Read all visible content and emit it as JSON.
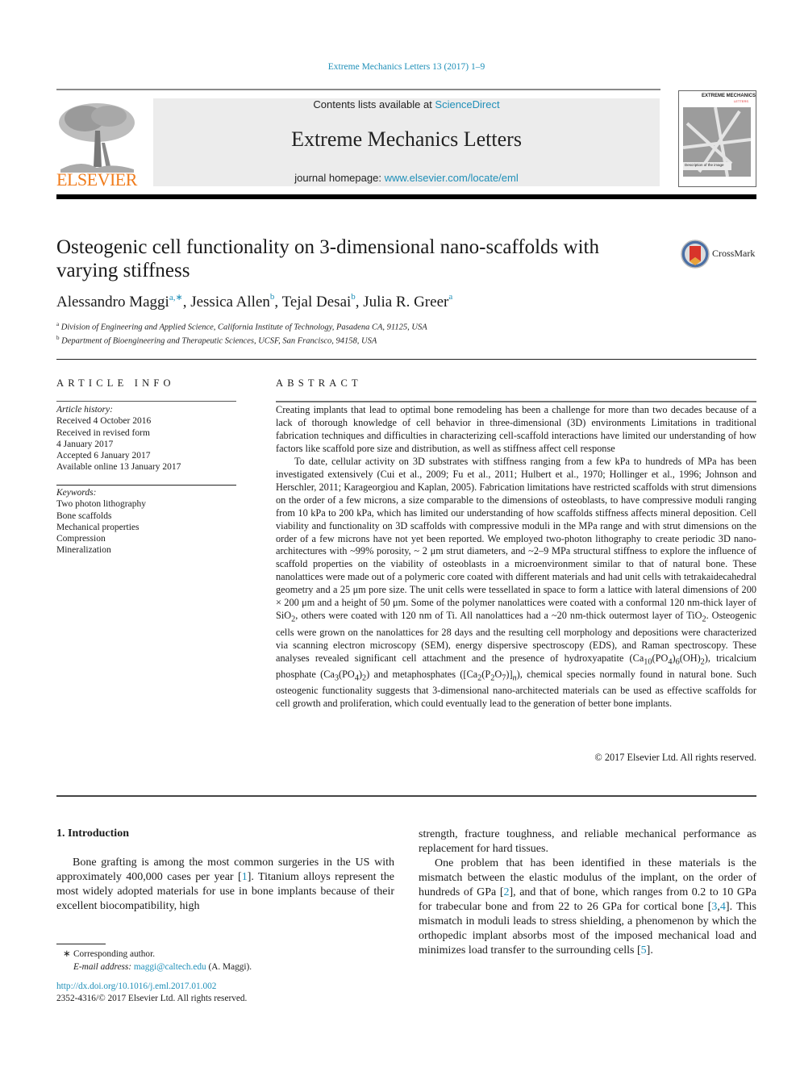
{
  "running_header": "Extreme Mechanics Letters 13 (2017) 1–9",
  "masthead": {
    "contents_prefix": "Contents lists available at ",
    "contents_link": "ScienceDirect",
    "journal_title": "Extreme Mechanics Letters",
    "homepage_prefix": "journal homepage: ",
    "homepage_link": "www.elsevier.com/locate/eml",
    "publisher_logo_text": "ELSEVIER",
    "cover_title": "EXTREME MECHANICS",
    "cover_subtitle": "LETTERS",
    "cover_caption": "Description of the image",
    "colors": {
      "link": "#1e8fb8",
      "elsevier_orange": "#f07c1c",
      "band": "#ececec"
    }
  },
  "article": {
    "title": "Osteogenic cell functionality on 3-dimensional nano-scaffolds with varying stiffness",
    "crossmark_label": "CrossMark",
    "authors": [
      {
        "name": "Alessandro Maggi",
        "sup": "a,∗"
      },
      {
        "name": "Jessica Allen",
        "sup": "b"
      },
      {
        "name": "Tejal Desai",
        "sup": "b"
      },
      {
        "name": "Julia R. Greer",
        "sup": "a"
      }
    ],
    "affiliations": [
      {
        "key": "a",
        "text": "Division of Engineering and Applied Science, California Institute of Technology, Pasadena CA, 91125, USA"
      },
      {
        "key": "b",
        "text": "Department of Bioengineering and Therapeutic Sciences, UCSF, San Francisco, 94158, USA"
      }
    ]
  },
  "article_info": {
    "heading": "ARTICLE INFO",
    "history_label": "Article history:",
    "history": [
      "Received 4 October 2016",
      "Received in revised form",
      "4 January 2017",
      "Accepted 6 January 2017",
      "Available online 13 January 2017"
    ],
    "keywords_label": "Keywords:",
    "keywords": [
      "Two photon lithography",
      "Bone scaffolds",
      "Mechanical properties",
      "Compression",
      "Mineralization"
    ]
  },
  "abstract": {
    "heading": "ABSTRACT",
    "p1": "Creating implants that lead to optimal bone remodeling has been a challenge for more than two decades because of a lack of thorough knowledge of cell behavior in three-dimensional (3D) environments Limitations in traditional fabrication techniques and difficulties in characterizing cell-scaffold interactions have limited our understanding of how factors like scaffold pore size and distribution, as well as stiffness affect cell response",
    "p2_a": "To date, cellular activity on 3D substrates with stiffness ranging from a few kPa to hundreds of MPa has been investigated extensively (Cui et al., 2009; Fu et al., 2011; Hulbert et al., 1970; Hollinger et al., 1996; Johnson and Herschler, 2011; Karageorgiou and Kaplan, 2005). Fabrication limitations have restricted scaffolds with strut dimensions on the order of a few microns, a size comparable to the dimensions of osteoblasts, to have compressive moduli ranging from 10 kPa to 200 kPa, which has limited our understanding of how scaffolds stiffness affects mineral deposition. Cell viability and functionality on 3D scaffolds with compressive moduli in the MPa range and with strut dimensions on the order of a few microns have not yet been reported. We employed two-photon lithography to create periodic 3D nano-architectures with ~99% porosity, ~ 2 μm strut diameters, and ~2–9 MPa structural stiffness to explore the influence of scaffold properties on the viability of osteoblasts in a microenvironment similar to that of natural bone. These nanolattices were made out of a polymeric core coated with different materials and had unit cells with tetrakaidecahedral geometry and a 25 μm pore size. The unit cells were tessellated in space to form a lattice with lateral dimensions of 200 × 200 μm and a height of 50 μm. Some of the polymer nanolattices were coated with a conformal 120 nm-thick layer of SiO",
    "p2_sub1": "2",
    "p2_b": ", others were coated with 120 nm of Ti. All nanolattices had a ~20 nm-thick outermost layer of TiO",
    "p2_sub2": "2",
    "p2_c": ". Osteogenic cells were grown on the nanolattices for 28 days and the resulting cell morphology and depositions were characterized via scanning electron microscopy (SEM), energy dispersive spectroscopy (EDS), and Raman spectroscopy. These analyses revealed significant cell attachment and the presence of hydroxyapatite (Ca",
    "f_ca10": "10",
    "f_po4_a": "(PO",
    "f_4a": "4",
    "f_6": "6",
    "f_oh": "(OH)",
    "f_2a": "2",
    "p2_d": "), tricalcium phosphate (Ca",
    "f_3": "3",
    "f_po4_b": "(PO",
    "f_4b": "4",
    "f_2b": "2",
    "p2_e": ") and metaphosphates ([Ca",
    "f_2c": "2",
    "f_p": "(P",
    "f_2d": "2",
    "f_o": "O",
    "f_7": "7",
    "f_n": "n",
    "p2_f": "), chemical species normally found in natural bone. Such osteogenic functionality suggests that 3-dimensional nano-architected materials can be used as effective scaffolds for cell growth and proliferation, which could eventually lead to the generation of better bone implants.",
    "copyright": "© 2017 Elsevier Ltd. All rights reserved."
  },
  "body": {
    "section_heading": "1. Introduction",
    "left_p1_a": "Bone grafting is among the most common surgeries in the US with approximately 400,000 cases per year [",
    "ref1": "1",
    "left_p1_b": "]. Titanium alloys represent the most widely adopted materials for use in bone implants because of their excellent biocompatibility, high",
    "right_p1": "strength, fracture toughness, and reliable mechanical performance as replacement for hard tissues.",
    "right_p2_a": "One problem that has been identified in these materials is the mismatch between the elastic modulus of the implant, on the order of hundreds of GPa [",
    "ref2": "2",
    "right_p2_b": "], and that of bone, which ranges from 0.2 to 10 GPa for trabecular bone and from 22 to 26 GPa for cortical bone [",
    "ref3": "3",
    "ref_sep": ",",
    "ref4": "4",
    "right_p2_c": "]. This mismatch in moduli leads to stress shielding, a phenomenon by which the orthopedic implant absorbs most of the imposed mechanical load and minimizes load transfer to the surrounding cells [",
    "ref5": "5",
    "right_p2_d": "]."
  },
  "footnotes": {
    "star": "∗",
    "corresponding": "Corresponding author.",
    "email_label": "E-mail address:",
    "email": "maggi@caltech.edu",
    "email_suffix": " (A. Maggi).",
    "doi": "http://dx.doi.org/10.1016/j.eml.2017.01.002",
    "issn_line": "2352-4316/© 2017 Elsevier Ltd. All rights reserved."
  }
}
